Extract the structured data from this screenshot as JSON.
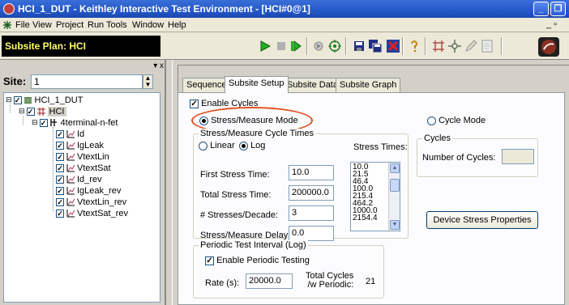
{
  "window": {
    "title": "HCI_1_DUT - Keithley Interactive Test Environment - [HCI#0@1]",
    "minimize_label": "_",
    "restore_label": "❐"
  },
  "menu": {
    "items": [
      "File",
      "View",
      "Project",
      "Run",
      "Tools",
      "Window",
      "Help"
    ],
    "mdi_controls": "_ ▫"
  },
  "toolbar": {
    "subsite_plan": "Subsite Plan: HCI"
  },
  "left_pane": {
    "site_label": "Site:",
    "site_value": "1",
    "pane_controls": "▾ x",
    "tree": [
      {
        "label": "HCI_1_DUT",
        "level": 0,
        "icon": "project-icon"
      },
      {
        "label": "HCI",
        "level": 1,
        "icon": "subsite-icon",
        "selected": true
      },
      {
        "label": "4terminal-n-fet",
        "level": 2,
        "icon": "device-icon"
      },
      {
        "label": "Id",
        "level": 3,
        "icon": "test-icon"
      },
      {
        "label": "IgLeak",
        "level": 3,
        "icon": "test-icon"
      },
      {
        "label": "VtextLin",
        "level": 3,
        "icon": "test-icon"
      },
      {
        "label": "VtextSat",
        "level": 3,
        "icon": "test-icon"
      },
      {
        "label": "Id_rev",
        "level": 3,
        "icon": "test-icon"
      },
      {
        "label": "IgLeak_rev",
        "level": 3,
        "icon": "test-icon"
      },
      {
        "label": "VtextLin_rev",
        "level": 3,
        "icon": "test-icon"
      },
      {
        "label": "VtextSat_rev",
        "level": 3,
        "icon": "test-icon"
      }
    ]
  },
  "tabs": [
    "Sequence",
    "Subsite Setup",
    "Subsite Data",
    "Subsite Graph"
  ],
  "active_tab": "Subsite Setup",
  "setup": {
    "enable_cycles_label": "Enable Cycles",
    "enable_cycles_checked": true,
    "stress_measure_mode_label": "Stress/Measure Mode",
    "cycle_mode_label": "Cycle Mode",
    "mode_selected": "stress_measure",
    "cycle_times_group": "Stress/Measure Cycle Times",
    "linear_label": "Linear",
    "log_label": "Log",
    "scale_selected": "log",
    "stress_times_label": "Stress Times:",
    "stress_times": [
      "10.0",
      "21.5",
      "46.4",
      "100.0",
      "215.4",
      "464.2",
      "1000.0",
      "2154.4"
    ],
    "first_stress_time_label": "First Stress Time:",
    "first_stress_time": "10.0",
    "total_stress_time_label": "Total Stress Time:",
    "total_stress_time": "200000.0",
    "stresses_per_decade_label": "# Stresses/Decade:",
    "stresses_per_decade": "3",
    "stress_measure_delay_label": "Stress/Measure Delay:",
    "stress_measure_delay": "0.0",
    "cycles_group": "Cycles",
    "number_of_cycles_label": "Number of Cycles:",
    "number_of_cycles": "",
    "device_stress_button": "Device Stress Properties",
    "periodic_group": "Periodic Test Interval (Log)",
    "enable_periodic_label": "Enable Periodic Testing",
    "enable_periodic_checked": true,
    "rate_label": "Rate (s):",
    "rate_value": "20000.0",
    "total_cycles_label_1": "Total Cycles",
    "total_cycles_label_2": "/w Periodic:",
    "total_cycles_value": "21"
  },
  "colors": {
    "annotation_ellipse": "#e05020",
    "subsite_plan_text": "#ffff66",
    "titlebar": "#2458c8"
  }
}
